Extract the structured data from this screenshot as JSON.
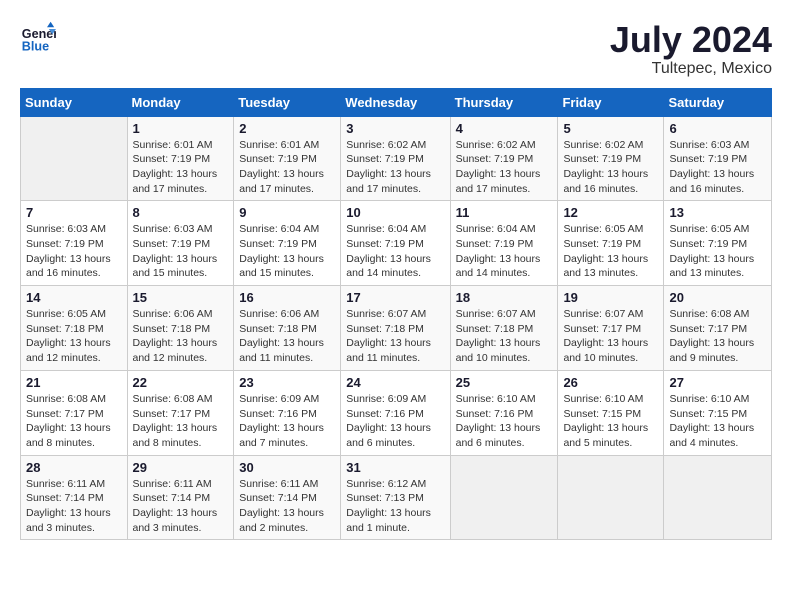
{
  "header": {
    "logo_general": "General",
    "logo_blue": "Blue",
    "month_year": "July 2024",
    "location": "Tultepec, Mexico"
  },
  "days_of_week": [
    "Sunday",
    "Monday",
    "Tuesday",
    "Wednesday",
    "Thursday",
    "Friday",
    "Saturday"
  ],
  "weeks": [
    [
      {
        "day": "",
        "sunrise": "",
        "sunset": "",
        "daylight": ""
      },
      {
        "day": "1",
        "sunrise": "Sunrise: 6:01 AM",
        "sunset": "Sunset: 7:19 PM",
        "daylight": "Daylight: 13 hours and 17 minutes."
      },
      {
        "day": "2",
        "sunrise": "Sunrise: 6:01 AM",
        "sunset": "Sunset: 7:19 PM",
        "daylight": "Daylight: 13 hours and 17 minutes."
      },
      {
        "day": "3",
        "sunrise": "Sunrise: 6:02 AM",
        "sunset": "Sunset: 7:19 PM",
        "daylight": "Daylight: 13 hours and 17 minutes."
      },
      {
        "day": "4",
        "sunrise": "Sunrise: 6:02 AM",
        "sunset": "Sunset: 7:19 PM",
        "daylight": "Daylight: 13 hours and 17 minutes."
      },
      {
        "day": "5",
        "sunrise": "Sunrise: 6:02 AM",
        "sunset": "Sunset: 7:19 PM",
        "daylight": "Daylight: 13 hours and 16 minutes."
      },
      {
        "day": "6",
        "sunrise": "Sunrise: 6:03 AM",
        "sunset": "Sunset: 7:19 PM",
        "daylight": "Daylight: 13 hours and 16 minutes."
      }
    ],
    [
      {
        "day": "7",
        "sunrise": "Sunrise: 6:03 AM",
        "sunset": "Sunset: 7:19 PM",
        "daylight": "Daylight: 13 hours and 16 minutes."
      },
      {
        "day": "8",
        "sunrise": "Sunrise: 6:03 AM",
        "sunset": "Sunset: 7:19 PM",
        "daylight": "Daylight: 13 hours and 15 minutes."
      },
      {
        "day": "9",
        "sunrise": "Sunrise: 6:04 AM",
        "sunset": "Sunset: 7:19 PM",
        "daylight": "Daylight: 13 hours and 15 minutes."
      },
      {
        "day": "10",
        "sunrise": "Sunrise: 6:04 AM",
        "sunset": "Sunset: 7:19 PM",
        "daylight": "Daylight: 13 hours and 14 minutes."
      },
      {
        "day": "11",
        "sunrise": "Sunrise: 6:04 AM",
        "sunset": "Sunset: 7:19 PM",
        "daylight": "Daylight: 13 hours and 14 minutes."
      },
      {
        "day": "12",
        "sunrise": "Sunrise: 6:05 AM",
        "sunset": "Sunset: 7:19 PM",
        "daylight": "Daylight: 13 hours and 13 minutes."
      },
      {
        "day": "13",
        "sunrise": "Sunrise: 6:05 AM",
        "sunset": "Sunset: 7:19 PM",
        "daylight": "Daylight: 13 hours and 13 minutes."
      }
    ],
    [
      {
        "day": "14",
        "sunrise": "Sunrise: 6:05 AM",
        "sunset": "Sunset: 7:18 PM",
        "daylight": "Daylight: 13 hours and 12 minutes."
      },
      {
        "day": "15",
        "sunrise": "Sunrise: 6:06 AM",
        "sunset": "Sunset: 7:18 PM",
        "daylight": "Daylight: 13 hours and 12 minutes."
      },
      {
        "day": "16",
        "sunrise": "Sunrise: 6:06 AM",
        "sunset": "Sunset: 7:18 PM",
        "daylight": "Daylight: 13 hours and 11 minutes."
      },
      {
        "day": "17",
        "sunrise": "Sunrise: 6:07 AM",
        "sunset": "Sunset: 7:18 PM",
        "daylight": "Daylight: 13 hours and 11 minutes."
      },
      {
        "day": "18",
        "sunrise": "Sunrise: 6:07 AM",
        "sunset": "Sunset: 7:18 PM",
        "daylight": "Daylight: 13 hours and 10 minutes."
      },
      {
        "day": "19",
        "sunrise": "Sunrise: 6:07 AM",
        "sunset": "Sunset: 7:17 PM",
        "daylight": "Daylight: 13 hours and 10 minutes."
      },
      {
        "day": "20",
        "sunrise": "Sunrise: 6:08 AM",
        "sunset": "Sunset: 7:17 PM",
        "daylight": "Daylight: 13 hours and 9 minutes."
      }
    ],
    [
      {
        "day": "21",
        "sunrise": "Sunrise: 6:08 AM",
        "sunset": "Sunset: 7:17 PM",
        "daylight": "Daylight: 13 hours and 8 minutes."
      },
      {
        "day": "22",
        "sunrise": "Sunrise: 6:08 AM",
        "sunset": "Sunset: 7:17 PM",
        "daylight": "Daylight: 13 hours and 8 minutes."
      },
      {
        "day": "23",
        "sunrise": "Sunrise: 6:09 AM",
        "sunset": "Sunset: 7:16 PM",
        "daylight": "Daylight: 13 hours and 7 minutes."
      },
      {
        "day": "24",
        "sunrise": "Sunrise: 6:09 AM",
        "sunset": "Sunset: 7:16 PM",
        "daylight": "Daylight: 13 hours and 6 minutes."
      },
      {
        "day": "25",
        "sunrise": "Sunrise: 6:10 AM",
        "sunset": "Sunset: 7:16 PM",
        "daylight": "Daylight: 13 hours and 6 minutes."
      },
      {
        "day": "26",
        "sunrise": "Sunrise: 6:10 AM",
        "sunset": "Sunset: 7:15 PM",
        "daylight": "Daylight: 13 hours and 5 minutes."
      },
      {
        "day": "27",
        "sunrise": "Sunrise: 6:10 AM",
        "sunset": "Sunset: 7:15 PM",
        "daylight": "Daylight: 13 hours and 4 minutes."
      }
    ],
    [
      {
        "day": "28",
        "sunrise": "Sunrise: 6:11 AM",
        "sunset": "Sunset: 7:14 PM",
        "daylight": "Daylight: 13 hours and 3 minutes."
      },
      {
        "day": "29",
        "sunrise": "Sunrise: 6:11 AM",
        "sunset": "Sunset: 7:14 PM",
        "daylight": "Daylight: 13 hours and 3 minutes."
      },
      {
        "day": "30",
        "sunrise": "Sunrise: 6:11 AM",
        "sunset": "Sunset: 7:14 PM",
        "daylight": "Daylight: 13 hours and 2 minutes."
      },
      {
        "day": "31",
        "sunrise": "Sunrise: 6:12 AM",
        "sunset": "Sunset: 7:13 PM",
        "daylight": "Daylight: 13 hours and 1 minute."
      },
      {
        "day": "",
        "sunrise": "",
        "sunset": "",
        "daylight": ""
      },
      {
        "day": "",
        "sunrise": "",
        "sunset": "",
        "daylight": ""
      },
      {
        "day": "",
        "sunrise": "",
        "sunset": "",
        "daylight": ""
      }
    ]
  ]
}
